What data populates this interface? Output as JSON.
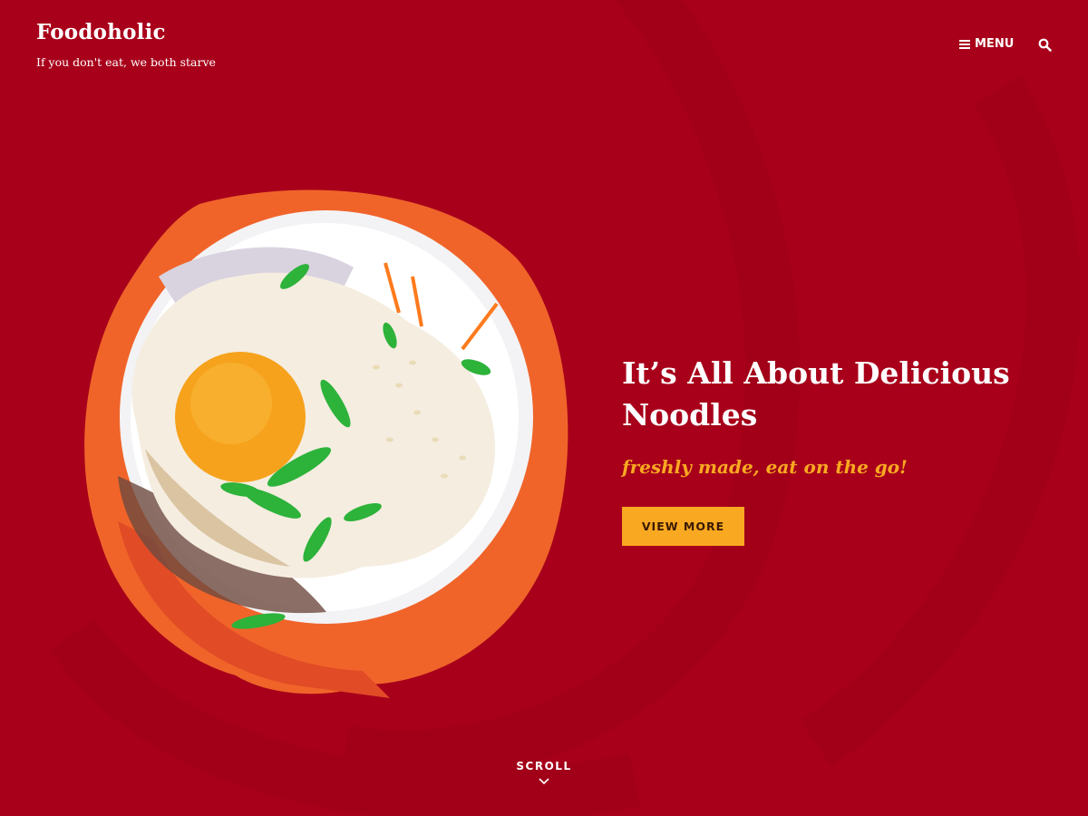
{
  "site": {
    "title": "Foodoholic",
    "tagline": "If you don't eat, we both starve"
  },
  "nav": {
    "menu_label": "MENU",
    "menu_icon": "hamburger-icon",
    "search_icon": "search-icon"
  },
  "hero": {
    "title": "It’s All About Delicious Noodles",
    "subtitle": "freshly made, eat on the go!",
    "cta_label": "VIEW MORE",
    "image": "noodle-bowl-with-fried-egg"
  },
  "scroll": {
    "label": "SCROLL",
    "icon": "chevron-down-icon"
  },
  "colors": {
    "background": "#a8001a",
    "accent": "#f9a921",
    "brush": "#f26a2c",
    "text": "#ffffff"
  }
}
